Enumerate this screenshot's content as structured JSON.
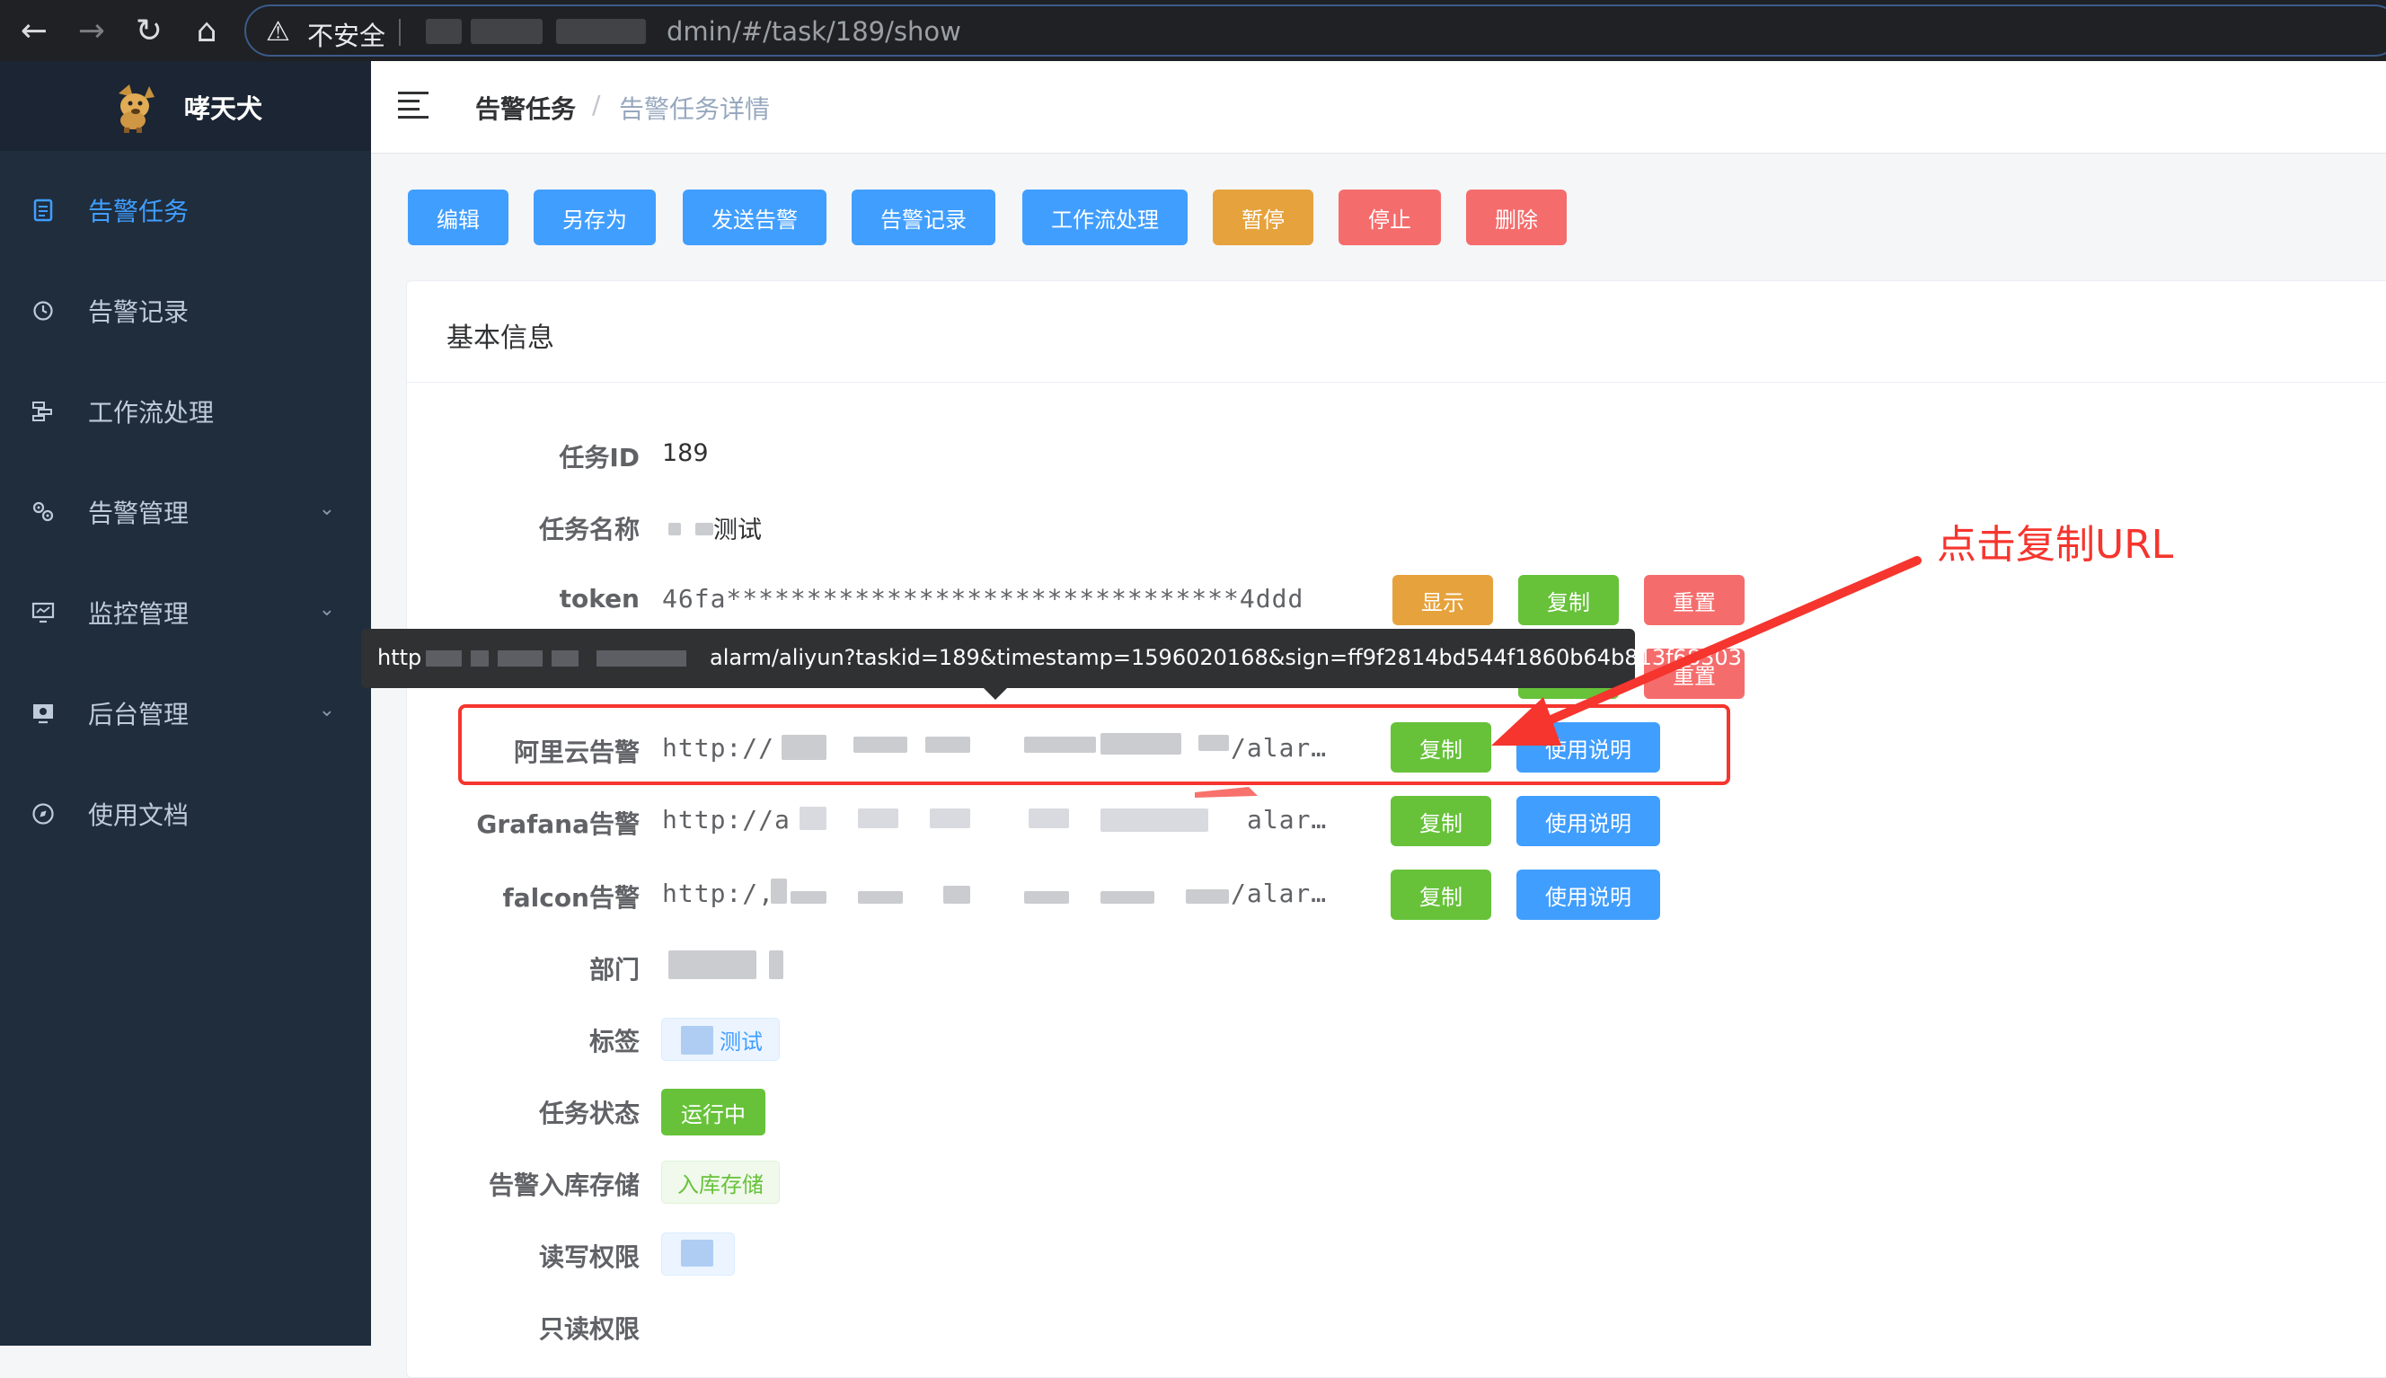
{
  "browser": {
    "insecure_label": "不安全",
    "url_visible": "dmin/#/task/189/show"
  },
  "app": {
    "name": "哮天犬"
  },
  "sidebar": {
    "items": [
      {
        "label": "告警任务",
        "icon": "document-icon",
        "active": true
      },
      {
        "label": "告警记录",
        "icon": "clock-icon"
      },
      {
        "label": "工作流处理",
        "icon": "workflow-icon"
      },
      {
        "label": "告警管理",
        "icon": "cogs-icon",
        "expandable": true
      },
      {
        "label": "监控管理",
        "icon": "monitor-icon",
        "expandable": true
      },
      {
        "label": "后台管理",
        "icon": "settings-icon",
        "expandable": true
      },
      {
        "label": "使用文档",
        "icon": "compass-icon"
      }
    ]
  },
  "breadcrumb": {
    "parent": "告警任务",
    "separator": "/",
    "current": "告警任务详情"
  },
  "actions": {
    "edit": "编辑",
    "save_as": "另存为",
    "send_alarm": "发送告警",
    "alarm_records": "告警记录",
    "workflow": "工作流处理",
    "pause": "暂停",
    "stop": "停止",
    "delete": "删除"
  },
  "card": {
    "title": "基本信息"
  },
  "fields": {
    "task_id_label": "任务ID",
    "task_id": "189",
    "task_name_label": "任务名称",
    "task_name": "测试",
    "token_label": "token",
    "token": "46fa********************************4ddd",
    "show_btn": "显示",
    "copy_btn": "复制",
    "reset_btn": "重置",
    "aliyun_label": "阿里云告警",
    "aliyun_url_prefix": "http://",
    "aliyun_url_suffix": "/alar…",
    "grafana_label": "Grafana告警",
    "grafana_url_prefix": "http://a",
    "grafana_url_suffix": "alar…",
    "falcon_label": "falcon告警",
    "falcon_url_prefix": "http:/,",
    "falcon_url_suffix": "/alar…",
    "usage_btn": "使用说明",
    "dept_label": "部门",
    "tag_label": "标签",
    "tag_value": "测试",
    "status_label": "任务状态",
    "status_value": "运行中",
    "storage_label": "告警入库存储",
    "storage_value": "入库存储",
    "rw_label": "读写权限",
    "ro_label": "只读权限"
  },
  "tooltip": {
    "prefix": "http",
    "text": "alarm/aliyun?taskid=189&timestamp=1596020168&sign=ff9f2814bd544f1860b64b813f683031"
  },
  "annotation": {
    "text": "点击复制URL",
    "color": "#f5352e"
  },
  "colors": {
    "primary": "#409eff",
    "success": "#67c23a",
    "warning": "#e6a23c",
    "danger": "#f56c6c",
    "sidebar_bg": "#1f2d3d"
  }
}
